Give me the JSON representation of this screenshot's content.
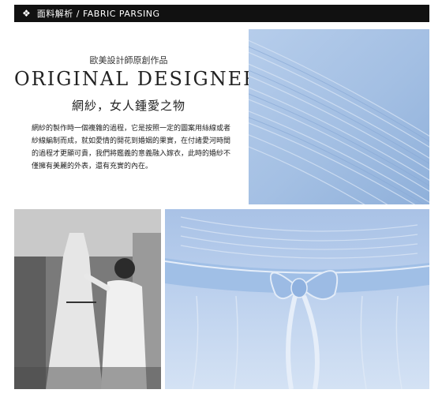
{
  "header": {
    "icon": "four-diamond-icon",
    "title": "面料解析 / FABRIC PARSING"
  },
  "intro": {
    "subtitle": "歐美設計師原創作品",
    "brand": "ORIGINAL DESIGNER",
    "slogan": "網紗，女人鍾愛之物",
    "paragraph_lines": [
      "網紗的製作時一個複雜的過程，它是按照一定的圖案用絲線或者",
      "紗線編制而成，就如愛情的開花到婚姻的果實，在付諸愛河時間",
      "的過程才更顯可貴，我們將鑑義的意義融入嫁衣，此時的婚紗不",
      "僅擁有美麗的外表，還有充實的內在。"
    ]
  },
  "images": {
    "fabric": "pleated-blue-tulle-closeup",
    "studio": "designer-fitting-dress-on-mannequin",
    "dress": "blue-dress-satin-bow-waist"
  },
  "colors": {
    "header_bg": "#111111",
    "fabric_blue": "#a9c4e6",
    "dress_blue": "#c3d6ee"
  }
}
